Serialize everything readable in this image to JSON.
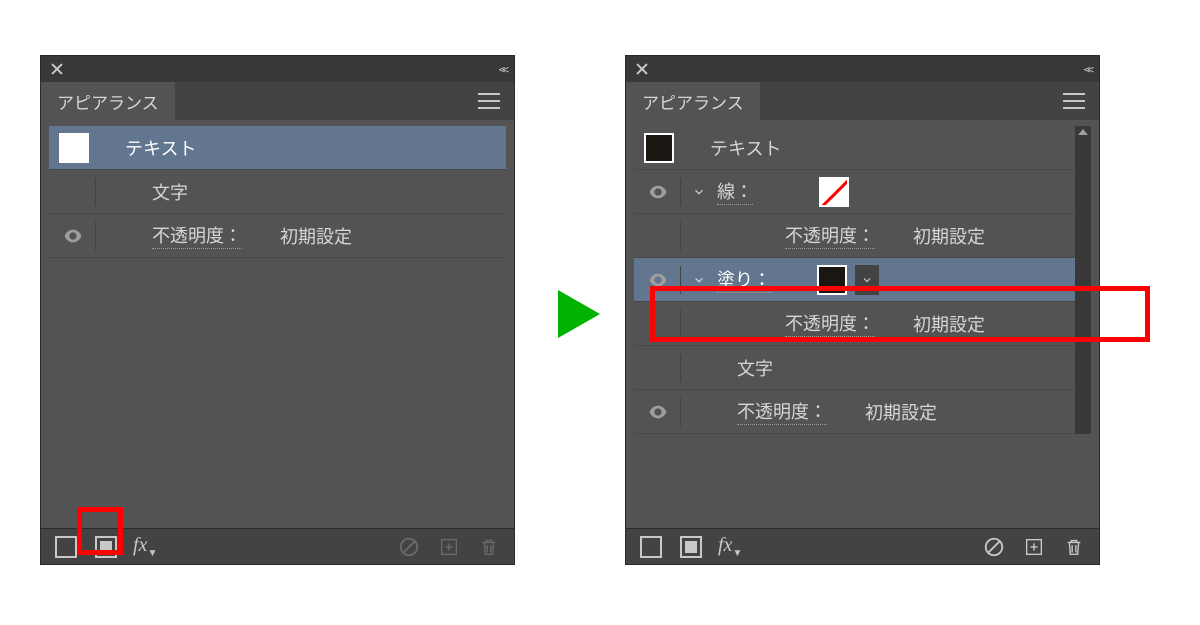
{
  "panel_title": "アピアランス",
  "left_panel": {
    "rows": [
      {
        "label": "テキスト",
        "swatch": "white"
      },
      {
        "label": "文字"
      },
      {
        "label": "不透明度：",
        "value": "初期設定"
      }
    ]
  },
  "right_panel": {
    "rows": [
      {
        "label": "テキスト",
        "swatch": "black"
      },
      {
        "label": "線：",
        "swatch": "none"
      },
      {
        "label": "不透明度：",
        "value": "初期設定",
        "indent": true
      },
      {
        "label": "塗り：",
        "swatch": "black",
        "fill": true
      },
      {
        "label": "不透明度：",
        "value": "初期設定",
        "indent": true
      },
      {
        "label": "文字"
      },
      {
        "label": "不透明度：",
        "value": "初期設定"
      }
    ]
  },
  "footer": {
    "fx": "fx"
  }
}
